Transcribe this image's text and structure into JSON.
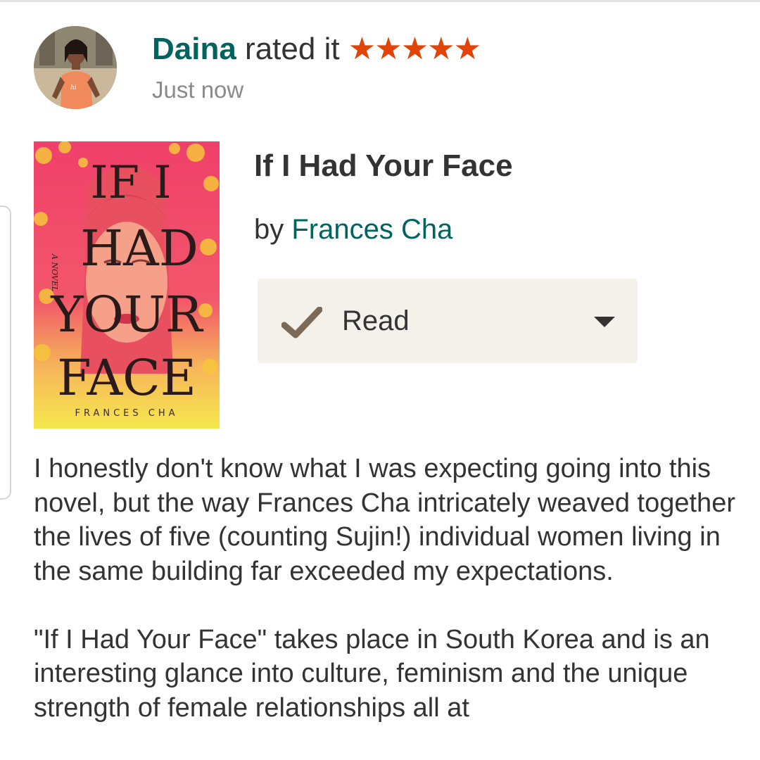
{
  "update": {
    "user_name": "Daina",
    "action_text": " rated it ",
    "stars_display": "★★★★★",
    "rating": 5,
    "rating_max": 5,
    "timestamp": "Just now",
    "avatar_icon": "user-avatar-photo"
  },
  "book": {
    "title": "If I Had Your Face",
    "by_label": "by ",
    "author": "Frances Cha",
    "cover": {
      "title_words": [
        "IF I",
        "HAD",
        "YOUR",
        "FACE"
      ],
      "tagline": "A NOVEL",
      "author": "FRANCES CHA"
    },
    "shelf": {
      "label": "Read",
      "check_icon": "checkmark-icon",
      "dropdown_icon": "caret-down-icon"
    }
  },
  "review": {
    "paragraphs": [
      "I honestly don't know what I was expecting going into this novel, but the way Frances Cha intricately weaved together the lives of five (counting Sujin!) individual women living in the same building far exceeded my expectations.",
      "\"If I Had Your Face\" takes place in South Korea and is an interesting glance into culture, feminism and the unique strength of female relationships all at"
    ]
  },
  "colors": {
    "link_green": "#00635d",
    "star_orange": "#e24408",
    "button_bg": "#f4f1ea",
    "check_brown": "#7b6a58",
    "cover_pink": "#ef4a6a",
    "cover_yellow": "#f6e84e"
  }
}
